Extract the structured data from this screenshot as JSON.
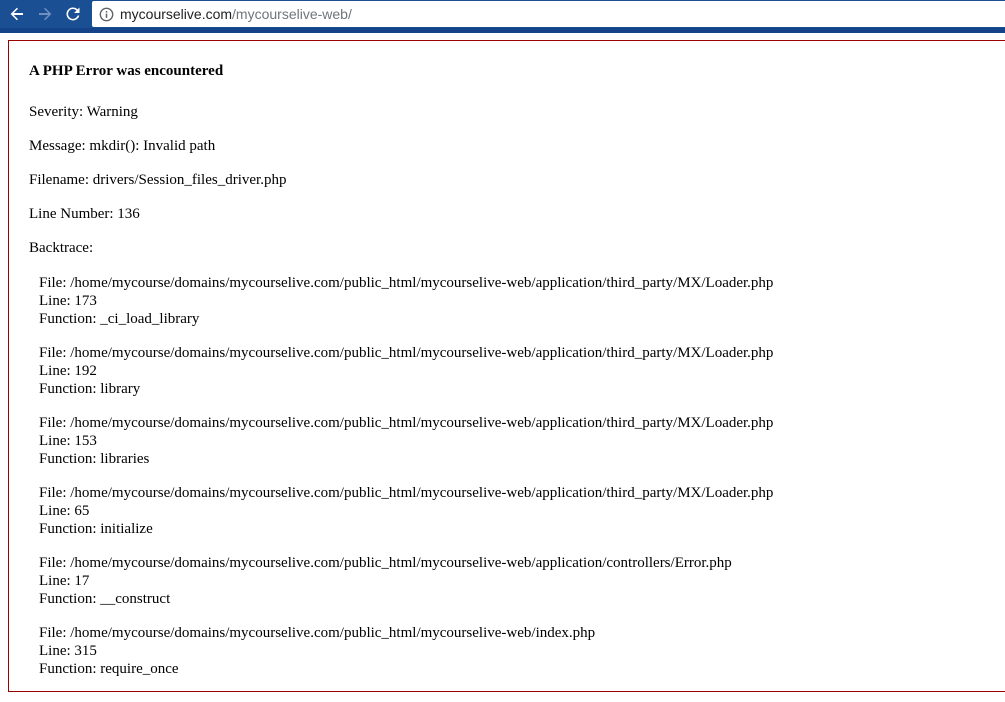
{
  "browser": {
    "url_host": "mycourselive.com",
    "url_path": "/mycourselive-web/",
    "back_icon": "arrow-left-icon",
    "forward_icon": "arrow-right-icon",
    "reload_icon": "reload-icon",
    "info_icon": "info-circle-icon"
  },
  "error": {
    "title": "A PHP Error was encountered",
    "severity": "Severity: Warning",
    "message": "Message: mkdir(): Invalid path",
    "filename": "Filename: drivers/Session_files_driver.php",
    "line_number": "Line Number: 136",
    "backtrace_label": "Backtrace:",
    "backtrace": [
      {
        "file": "File: /home/mycourse/domains/mycourselive.com/public_html/mycourselive-web/application/third_party/MX/Loader.php",
        "line": "Line: 173",
        "function": "Function: _ci_load_library"
      },
      {
        "file": "File: /home/mycourse/domains/mycourselive.com/public_html/mycourselive-web/application/third_party/MX/Loader.php",
        "line": "Line: 192",
        "function": "Function: library"
      },
      {
        "file": "File: /home/mycourse/domains/mycourselive.com/public_html/mycourselive-web/application/third_party/MX/Loader.php",
        "line": "Line: 153",
        "function": "Function: libraries"
      },
      {
        "file": "File: /home/mycourse/domains/mycourselive.com/public_html/mycourselive-web/application/third_party/MX/Loader.php",
        "line": "Line: 65",
        "function": "Function: initialize"
      },
      {
        "file": "File: /home/mycourse/domains/mycourselive.com/public_html/mycourselive-web/application/controllers/Error.php",
        "line": "Line: 17",
        "function": "Function: __construct"
      },
      {
        "file": "File: /home/mycourse/domains/mycourselive.com/public_html/mycourselive-web/index.php",
        "line": "Line: 315",
        "function": "Function: require_once"
      }
    ]
  },
  "colors": {
    "chrome": "#1b4f93",
    "error_border": "#990000"
  }
}
